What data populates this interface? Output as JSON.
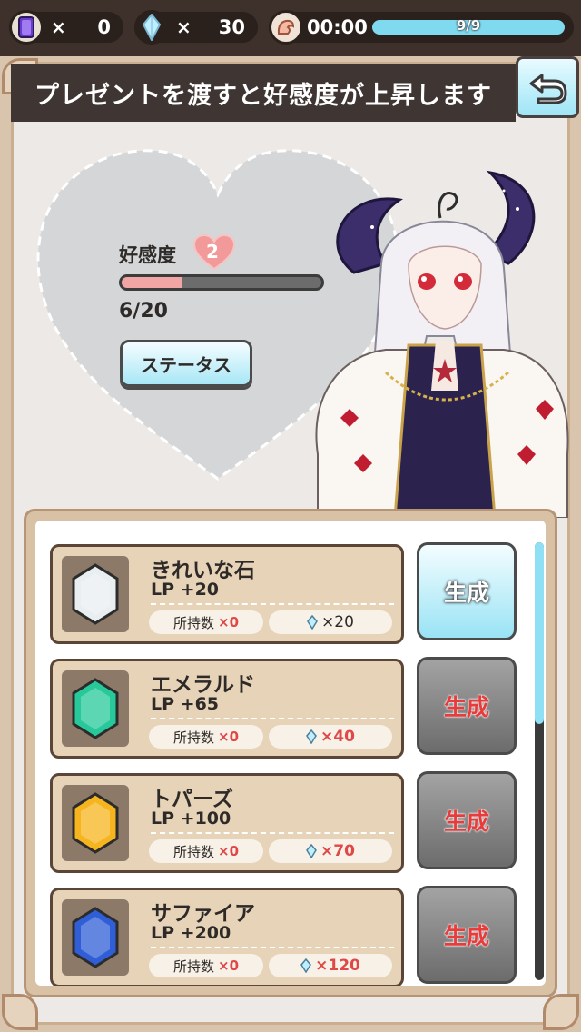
{
  "header": {
    "cards": {
      "x": "×",
      "value": "0"
    },
    "crystals": {
      "x": "×",
      "value": "30"
    },
    "stamina": {
      "time": "00:00",
      "text": "9/9",
      "fraction": 1.0
    }
  },
  "title": "プレゼントを渡すと好感度が上昇します",
  "affection": {
    "label": "好感度",
    "level": "2",
    "count": "6/20",
    "progress_fraction": 0.3,
    "status_button": "ステータス"
  },
  "items": [
    {
      "name": "きれいな石",
      "lp": "LP +20",
      "owned_label": "所持数",
      "owned": "×0",
      "cost": "×20",
      "button": "生成",
      "enabled": true,
      "gem_color": "#e9eef0"
    },
    {
      "name": "エメラルド",
      "lp": "LP +65",
      "owned_label": "所持数",
      "owned": "×0",
      "cost": "×40",
      "button": "生成",
      "enabled": false,
      "gem_color": "#27c99a"
    },
    {
      "name": "トパーズ",
      "lp": "LP +100",
      "owned_label": "所持数",
      "owned": "×0",
      "cost": "×70",
      "button": "生成",
      "enabled": false,
      "gem_color": "#f6b51e"
    },
    {
      "name": "サファイア",
      "lp": "LP +200",
      "owned_label": "所持数",
      "owned": "×0",
      "cost": "×120",
      "button": "生成",
      "enabled": false,
      "gem_color": "#2f5ed6"
    }
  ],
  "colors": {
    "accent": "#8fe0f5",
    "affection_fill": "#f2a5a5",
    "title_bg": "#3f3533"
  },
  "icons": [
    "card-icon",
    "crystal-icon",
    "stamina-arm-icon",
    "back-arrow-icon",
    "heart-icon",
    "gem-icon"
  ]
}
